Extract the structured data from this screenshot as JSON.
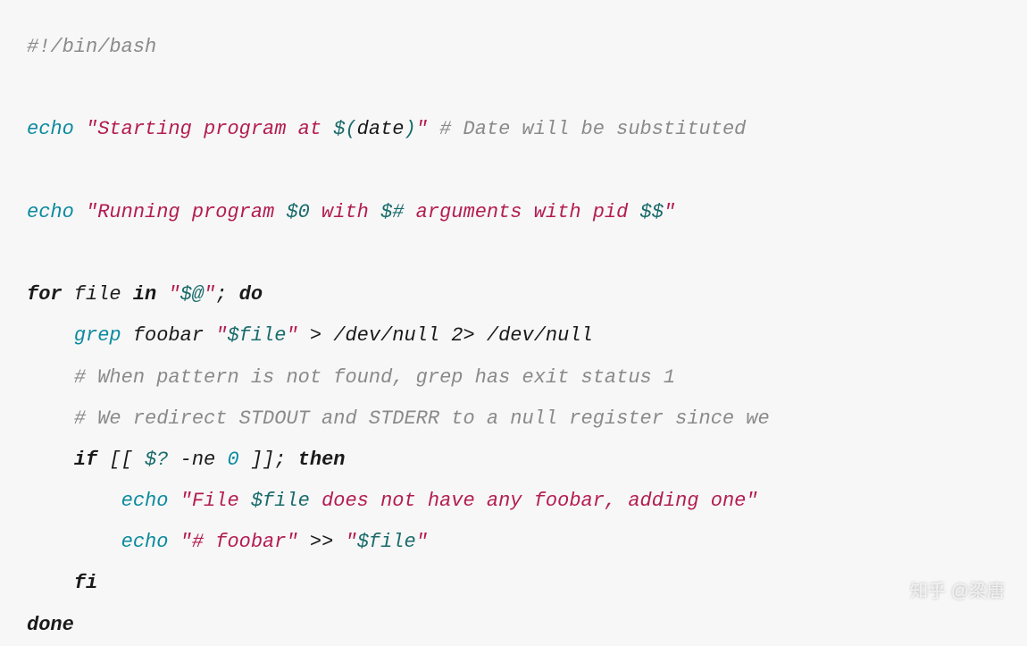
{
  "code": {
    "line1_shebang": "#!/bin/bash",
    "line3_echo": "echo",
    "line3_str1": "\"Starting program at ",
    "line3_cmd_open": "$(",
    "line3_date": "date",
    "line3_cmd_close": ")",
    "line3_str2": "\"",
    "line3_comment": " # Date will be substituted",
    "line5_echo": "echo",
    "line5_str1": "\"Running program ",
    "line5_var1": "$0",
    "line5_str2": " with ",
    "line5_var2": "$#",
    "line5_str3": " arguments with pid ",
    "line5_var3": "$$",
    "line5_str4": "\"",
    "line7_for": "for",
    "line7_file": " file ",
    "line7_in": "in",
    "line7_str1": " \"",
    "line7_var": "$@",
    "line7_str2": "\"",
    "line7_semi": "; ",
    "line7_do": "do",
    "line8_indent": "    ",
    "line8_grep": "grep",
    "line8_foobar": " foobar ",
    "line8_str1": "\"",
    "line8_var": "$file",
    "line8_str2": "\"",
    "line8_redir": " > /dev/null 2> /dev/null",
    "line9_indent": "    ",
    "line9_comment": "# When pattern is not found, grep has exit status 1",
    "line10_indent": "    ",
    "line10_comment": "# We redirect STDOUT and STDERR to a null register since we ",
    "line11_indent": "    ",
    "line11_if": "if",
    "line11_bracket1": " [[ ",
    "line11_var": "$?",
    "line11_ne": " -ne ",
    "line11_zero": "0",
    "line11_bracket2": " ]]; ",
    "line11_then": "then",
    "line12_indent": "        ",
    "line12_echo": "echo",
    "line12_str1": " \"File ",
    "line12_var": "$file",
    "line12_str2": " does not have any foobar, adding one\"",
    "line13_indent": "        ",
    "line13_echo": "echo",
    "line13_str1": " \"# foobar\"",
    "line13_redir": " >> ",
    "line13_str2": "\"",
    "line13_var": "$file",
    "line13_str3": "\"",
    "line14_indent": "    ",
    "line14_fi": "fi",
    "line15_done": "done"
  },
  "watermark": "知乎 @梁唐"
}
